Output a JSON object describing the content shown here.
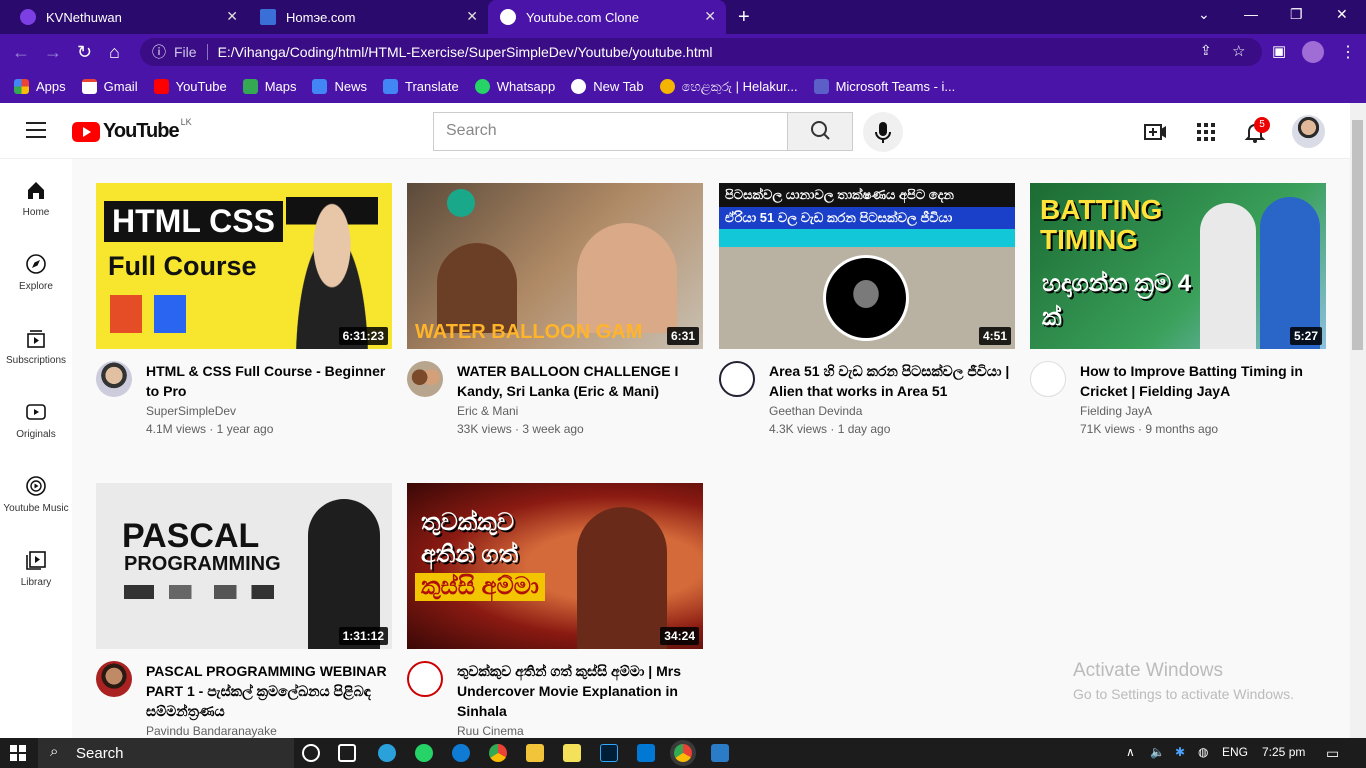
{
  "browser": {
    "tabs": [
      {
        "label": "KVNethuwan"
      },
      {
        "label": "Homэe.com"
      },
      {
        "label": "Youtube.com Clone"
      }
    ],
    "new_tab": "+",
    "url_prefix": "File",
    "url": "E:/Vihanga/Coding/html/HTML-Exercise/SuperSimpleDev/Youtube/youtube.html",
    "bookmarks": [
      {
        "label": "Apps",
        "color": "#ea4335"
      },
      {
        "label": "Gmail",
        "color": "#ea4335"
      },
      {
        "label": "YouTube",
        "color": "#ff0000"
      },
      {
        "label": "Maps",
        "color": "#34a853"
      },
      {
        "label": "News",
        "color": "#4285f4"
      },
      {
        "label": "Translate",
        "color": "#4285f4"
      },
      {
        "label": "Whatsapp",
        "color": "#25d366"
      },
      {
        "label": "New Tab",
        "color": "#ffffff"
      },
      {
        "label": "හෙළකුරු | Helakur...",
        "color": "#f4b400"
      },
      {
        "label": "Microsoft Teams - i...",
        "color": "#5b5fc7"
      }
    ]
  },
  "youtube": {
    "logo_text": "YouTube",
    "country": "LK",
    "search_placeholder": "Search",
    "notification_count": "5",
    "sidebar": [
      {
        "label": "Home",
        "icon": "home-icon"
      },
      {
        "label": "Explore",
        "icon": "explore-icon"
      },
      {
        "label": "Subscriptions",
        "icon": "subscriptions-icon"
      },
      {
        "label": "Originals",
        "icon": "originals-icon"
      },
      {
        "label": "Youtube Music",
        "icon": "music-icon"
      },
      {
        "label": "Library",
        "icon": "library-icon"
      }
    ],
    "videos": [
      {
        "title": "HTML & CSS Full Course - Beginner to Pro",
        "channel": "SuperSimpleDev",
        "stats": "4.1M views · 1 year ago",
        "duration": "6:31:23",
        "thumb_text": "HTML CSS",
        "thumb_sub": "Full Course",
        "thumb_color": "#f7e52e"
      },
      {
        "title": "WATER BALLOON CHALLENGE I Kandy, Sri Lanka (Eric & Mani)",
        "channel": "Eric & Mani",
        "stats": "33K views · 3 week ago",
        "duration": "6:31",
        "thumb_text": "WATER BALLOON GAM",
        "thumb_sub": "",
        "thumb_color": "#8a6a4a"
      },
      {
        "title": "Area 51 හි වැඩ කරන පිටසක්වල ජීවියා | Alien that works in Area 51",
        "channel": "Geethan Devinda",
        "stats": "4.3K views · 1 day ago",
        "duration": "4:51",
        "thumb_text": "පිටසක්වල යානාවල තාක්ෂණය අපිට දෙන",
        "thumb_sub": "ඒරියා 51 වල වැඩ කරන පිටසක්වල ජීවියා",
        "thumb_color": "#b9b2a3"
      },
      {
        "title": "How to Improve Batting Timing in Cricket | Fielding JayA",
        "channel": "Fielding JayA",
        "stats": "71K views · 9 months ago",
        "duration": "5:27",
        "thumb_text": "BATTING TIMING",
        "thumb_sub": "හදාගන්න ක්‍රම 4 ක්",
        "thumb_color": "#1f7a3a"
      },
      {
        "title": "PASCAL PROGRAMMING WEBINAR PART 1 - පැස්කල් ක්‍රමලේඛනය පිළිබඳ සම්මන්ත්‍රණය",
        "channel": "Pavindu Bandaranayake",
        "stats": "",
        "duration": "1:31:12",
        "thumb_text": "PASCAL",
        "thumb_sub": "PROGRAMMING",
        "thumb_color": "#eaeaea"
      },
      {
        "title": "තුවක්කුව අතින් ගත් කුස්සි අම්මා | Mrs Undercover Movie Explanation in Sinhala",
        "channel": "Ruu Cinema",
        "stats": "",
        "duration": "34:24",
        "thumb_text": "තුවක්කුව අතින් ගත්",
        "thumb_sub": "කුස්සි අම්මා",
        "thumb_color": "#8a1a12"
      }
    ],
    "watermark": {
      "line1": "Activate Windows",
      "line2": "Go to Settings to activate Windows."
    }
  },
  "taskbar": {
    "search": "Search",
    "lang": "ENG",
    "time": "7:25 pm"
  }
}
